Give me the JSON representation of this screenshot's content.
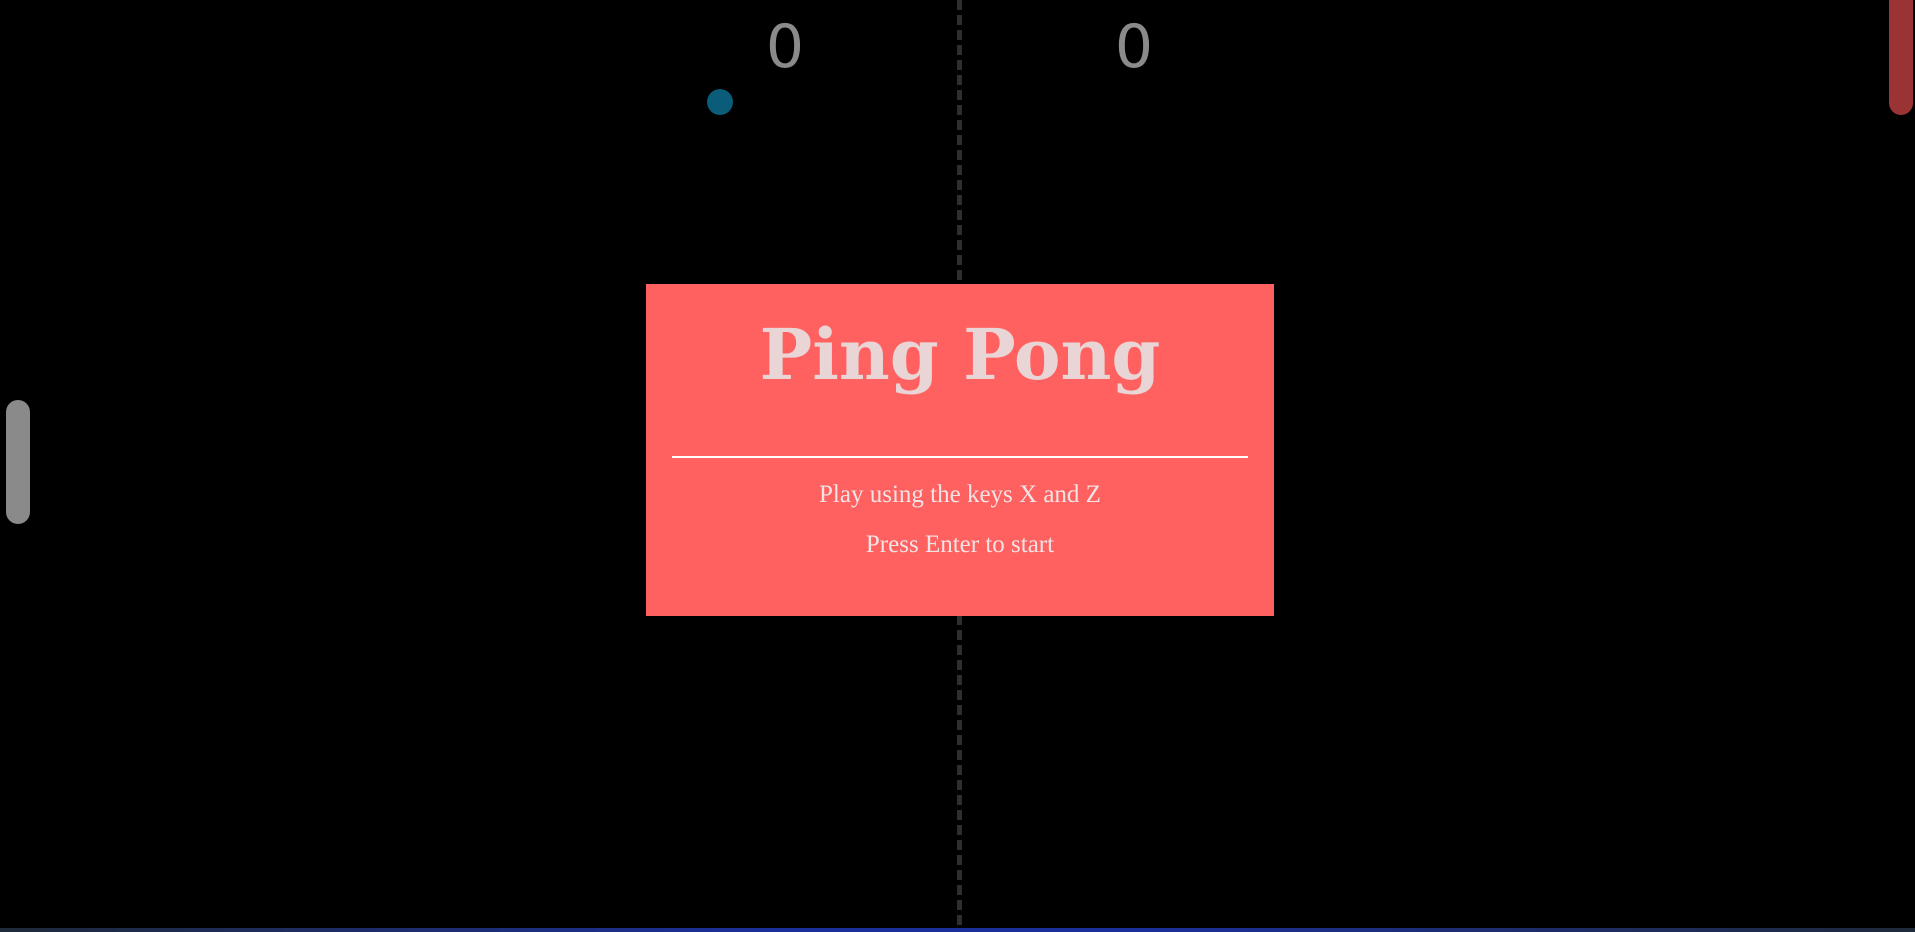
{
  "game": {
    "title": "Ping Pong",
    "instructions": "Play using the keys X and Z",
    "start_prompt": "Press Enter to start"
  },
  "scores": {
    "left": "0",
    "right": "0"
  },
  "colors": {
    "background": "#000000",
    "panel": "#ff6161",
    "ball": "#0a5c78",
    "left_paddle": "#8a8a8a",
    "right_paddle": "#9a3434",
    "net": "#2e2e2e",
    "score": "#8a8a8a"
  }
}
